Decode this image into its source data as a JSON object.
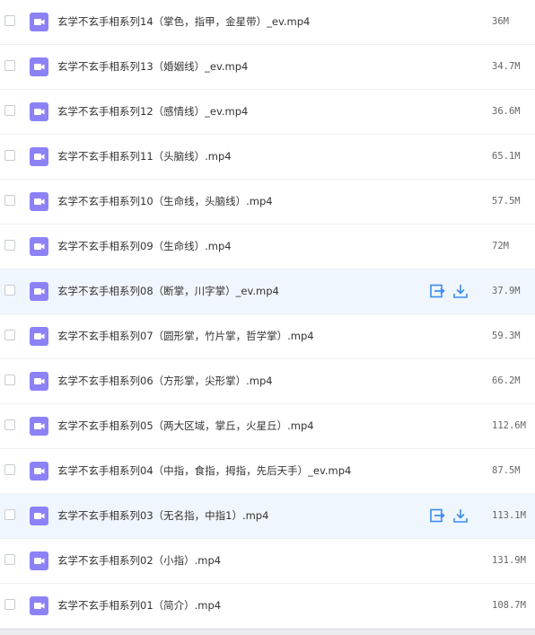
{
  "files": [
    {
      "name": "玄学不玄手相系列14（掌色，指甲，金星带）_ev.mp4",
      "size": "36M",
      "hover": false
    },
    {
      "name": "玄学不玄手相系列13（婚姻线）_ev.mp4",
      "size": "34.7M",
      "hover": false
    },
    {
      "name": "玄学不玄手相系列12（感情线）_ev.mp4",
      "size": "36.6M",
      "hover": false
    },
    {
      "name": "玄学不玄手相系列11（头脑线）.mp4",
      "size": "65.1M",
      "hover": false
    },
    {
      "name": "玄学不玄手相系列10（生命线，头脑线）.mp4",
      "size": "57.5M",
      "hover": false
    },
    {
      "name": "玄学不玄手相系列09（生命线）.mp4",
      "size": "72M",
      "hover": false
    },
    {
      "name": "玄学不玄手相系列08（断掌，川字掌）_ev.mp4",
      "size": "37.9M",
      "hover": true
    },
    {
      "name": "玄学不玄手相系列07（圆形掌，竹片掌，哲学掌）.mp4",
      "size": "59.3M",
      "hover": false
    },
    {
      "name": "玄学不玄手相系列06（方形掌，尖形掌）.mp4",
      "size": "66.2M",
      "hover": false
    },
    {
      "name": "玄学不玄手相系列05（两大区域，掌丘，火星丘）.mp4",
      "size": "112.6M",
      "hover": false
    },
    {
      "name": "玄学不玄手相系列04（中指，食指，拇指，先后天手）_ev.mp4",
      "size": "87.5M",
      "hover": false
    },
    {
      "name": "玄学不玄手相系列03（无名指，中指1）.mp4",
      "size": "113.1M",
      "hover": true
    },
    {
      "name": "玄学不玄手相系列02（小指）.mp4",
      "size": "131.9M",
      "hover": false
    },
    {
      "name": "玄学不玄手相系列01（简介）.mp4",
      "size": "108.7M",
      "hover": false
    }
  ],
  "icons": {
    "file": "video-file-icon",
    "share": "share-icon",
    "download": "download-icon"
  },
  "colors": {
    "video_icon_bg": "#8c82f5",
    "action_icon": "#3b8cf0",
    "hover_row_bg": "#f0f6fd"
  }
}
